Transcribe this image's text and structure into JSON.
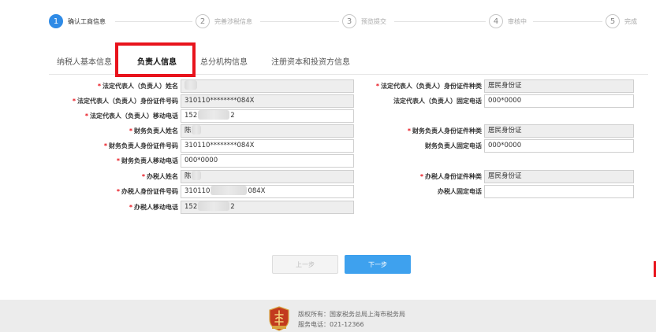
{
  "steps": [
    {
      "num": "1",
      "label": "确认工商信息"
    },
    {
      "num": "2",
      "label": "完善涉税信息"
    },
    {
      "num": "3",
      "label": "预览提交"
    },
    {
      "num": "4",
      "label": "审核中"
    },
    {
      "num": "5",
      "label": "完成"
    }
  ],
  "tabs": [
    {
      "label": "纳税人基本信息"
    },
    {
      "label": "负责人信息"
    },
    {
      "label": "总分机构信息"
    },
    {
      "label": "注册资本和投资方信息"
    }
  ],
  "form": {
    "left": [
      {
        "label": "法定代表人（负责人）姓名",
        "required": true,
        "value": ""
      },
      {
        "label": "法定代表人（负责人）身份证件号码",
        "required": true,
        "value": "310110********084X"
      },
      {
        "label": "法定代表人（负责人）移动电话",
        "required": true,
        "value": "152",
        "suffix": "2"
      },
      {
        "label": "财务负责人姓名",
        "required": true,
        "value": "",
        "prefix": "陈"
      },
      {
        "label": "财务负责人身份证件号码",
        "required": true,
        "value": "310110********084X"
      },
      {
        "label": "财务负责人移动电话",
        "required": true,
        "value": "000*0000"
      },
      {
        "label": "办税人姓名",
        "required": true,
        "value": "",
        "prefix": "陈"
      },
      {
        "label": "办税人身份证件号码",
        "required": true,
        "value": "310110",
        "suffix": "084X"
      },
      {
        "label": "办税人移动电话",
        "required": true,
        "value": "152",
        "suffix": "2"
      }
    ],
    "right": [
      {
        "label": "法定代表人（负责人）身份证件种类",
        "required": true,
        "value": "居民身份证",
        "readonly": true
      },
      {
        "label": "法定代表人（负责人）固定电话",
        "required": false,
        "value": "000*0000",
        "readonly": false
      },
      {
        "label": "财务负责人身份证件种类",
        "required": true,
        "value": "居民身份证",
        "readonly": true
      },
      {
        "label": "财务负责人固定电话",
        "required": false,
        "value": "000*0000",
        "readonly": false
      },
      {
        "label": "办税人身份证件种类",
        "required": true,
        "value": "居民身份证",
        "readonly": true
      },
      {
        "label": "办税人固定电话",
        "required": false,
        "value": "",
        "readonly": false
      }
    ]
  },
  "buttons": {
    "prev": "上一步",
    "next": "下一步"
  },
  "footer": {
    "copyright": "版权所有：国家税务总局上海市税务局",
    "phone": "服务电话：021-12366"
  },
  "colors": {
    "accent": "#2f8be6",
    "highlight": "#e8131c",
    "next_button": "#3ea1ee"
  },
  "icons": {
    "footer_logo": "tax-emblem-icon"
  }
}
